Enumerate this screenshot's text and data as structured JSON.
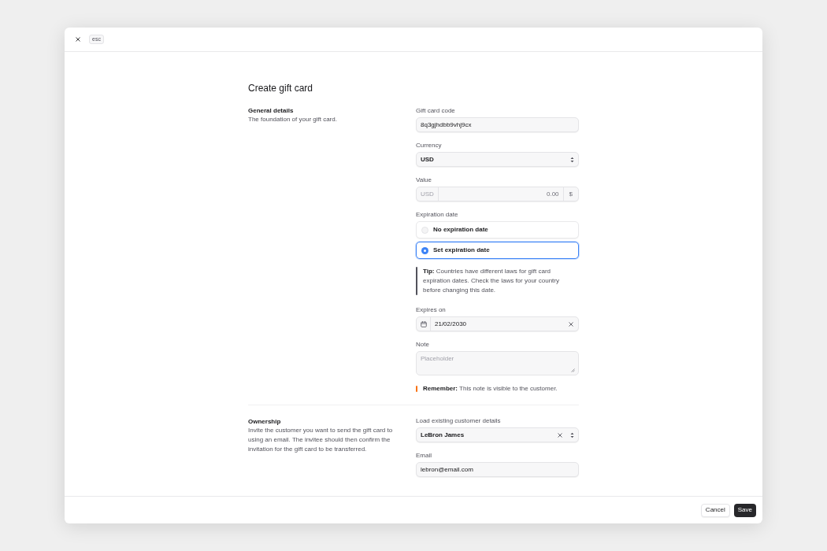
{
  "header": {
    "close_key": "esc"
  },
  "title": "Create gift card",
  "general": {
    "heading": "General details",
    "description": "The foundation of your gift card."
  },
  "gift_card_code": {
    "label": "Gift card code",
    "value": "8q3gjhdbb9vhj9cx"
  },
  "currency": {
    "label": "Currency",
    "value": "USD"
  },
  "value": {
    "label": "Value",
    "prefix": "USD",
    "amount": "0.00",
    "suffix": "$"
  },
  "expiration": {
    "label": "Expiration date",
    "options": [
      {
        "label": "No expiration date",
        "selected": false
      },
      {
        "label": "Set expiration date",
        "selected": true
      }
    ]
  },
  "tip": "**Tip:** Countries have different laws for gift card expiration dates. Check the laws for your country before changing this date.",
  "expires_on": {
    "label": "Expires on",
    "value": "21/02/2030"
  },
  "note": {
    "label": "Note",
    "placeholder": "Placeholder"
  },
  "remember": "**Remember:** This note is visible to the customer.",
  "ownership": {
    "heading": "Ownership",
    "description": "Invite the customer you want to send the gift card to using an email. The invitee should then confirm the invitation for the gift card to be transferred."
  },
  "customer": {
    "label": "Load existing customer details",
    "value": "LeBron James"
  },
  "email": {
    "label": "Email",
    "value": "lebron@email.com"
  },
  "buttons": [
    {
      "label": "Cancel",
      "kind": "secondary"
    },
    {
      "label": "Save",
      "kind": "primary"
    }
  ]
}
